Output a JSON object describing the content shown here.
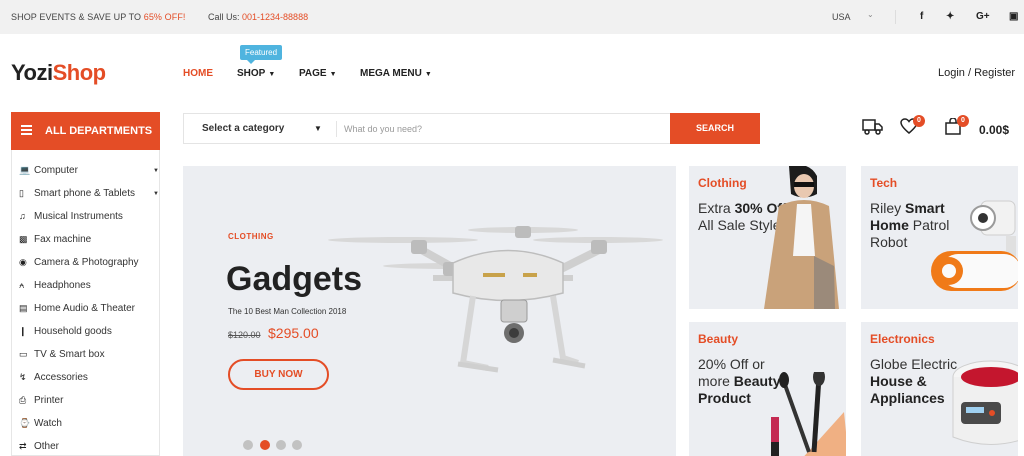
{
  "topbar": {
    "promo_prefix": "SHOP EVENTS & SAVE UP TO ",
    "promo_accent": "65% OFF!",
    "call_prefix": "Call Us: ",
    "call_number": "001-1234-88888",
    "country": "USA",
    "social": [
      "f",
      "t",
      "G+",
      "ig"
    ]
  },
  "header": {
    "logo_main": "Yozi",
    "logo_accent": "Shop",
    "featured_badge": "Featured",
    "nav": [
      "HOME",
      "SHOP",
      "PAGE",
      "MEGA MENU"
    ],
    "login": "Login / Register"
  },
  "departments": {
    "title": "ALL DEPARTMENTS",
    "items": [
      {
        "label": "Computer",
        "icon": "laptop-icon",
        "sub": true
      },
      {
        "label": "Smart phone & Tablets",
        "icon": "phone-icon",
        "sub": true
      },
      {
        "label": "Musical Instruments",
        "icon": "music-icon",
        "sub": false
      },
      {
        "label": "Fax machine",
        "icon": "fax-icon",
        "sub": false
      },
      {
        "label": "Camera & Photography",
        "icon": "camera-icon",
        "sub": false
      },
      {
        "label": "Headphones",
        "icon": "headphones-icon",
        "sub": false
      },
      {
        "label": "Home Audio & Theater",
        "icon": "speaker-icon",
        "sub": false
      },
      {
        "label": "Household goods",
        "icon": "household-icon",
        "sub": false
      },
      {
        "label": "TV & Smart box",
        "icon": "tv-icon",
        "sub": false
      },
      {
        "label": "Accessories",
        "icon": "bolt-icon",
        "sub": false
      },
      {
        "label": "Printer",
        "icon": "printer-icon",
        "sub": false
      },
      {
        "label": "Watch",
        "icon": "watch-icon",
        "sub": false
      },
      {
        "label": "Other",
        "icon": "shuffle-icon",
        "sub": false
      }
    ]
  },
  "search": {
    "category": "Select a category",
    "placeholder": "What do you need?",
    "button": "SEARCH"
  },
  "header_icons": {
    "wishlist_count": "0",
    "cart_count": "0",
    "cart_total": "0.00$"
  },
  "hero": {
    "eyebrow": "CLOTHING",
    "title": "Gadgets",
    "subtitle": "The 10 Best Man Collection 2018",
    "old_price": "$120.00",
    "price": "$295.00",
    "button": "BUY NOW",
    "slides": 4,
    "active_slide": 2
  },
  "cards": [
    {
      "title": "Clothing",
      "desc_plain_1": "Extra ",
      "desc_bold_1": "30% Off",
      "desc_plain_2": " All Sale Styles"
    },
    {
      "title": "Tech",
      "desc_plain_1": "Riley ",
      "desc_bold_1": "Smart Home",
      "desc_plain_2": " Patrol Robot"
    },
    {
      "title": "Beauty",
      "desc_plain_1": "20% Off or more ",
      "desc_bold_1": "Beauty Product",
      "desc_plain_2": ""
    },
    {
      "title": "Electronics",
      "desc_plain_1": "Globe Electric ",
      "desc_bold_1": "House & Appliances",
      "desc_plain_2": ""
    }
  ],
  "colors": {
    "accent": "#e44d26",
    "featured": "#4fb4df",
    "panel_bg": "#eceef2"
  }
}
